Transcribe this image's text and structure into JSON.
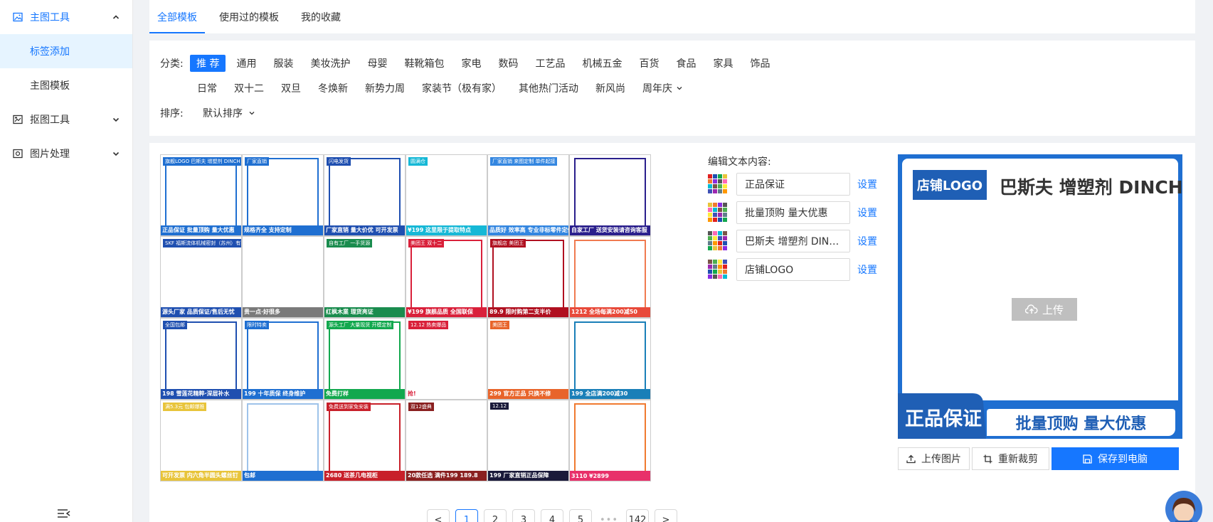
{
  "sidebar": {
    "groups": [
      {
        "label": "主图工具",
        "icon": "image-icon",
        "expanded": true,
        "children": [
          "标签添加",
          "主图模板"
        ]
      },
      {
        "label": "抠图工具",
        "icon": "cutout-icon",
        "expanded": false
      },
      {
        "label": "图片处理",
        "icon": "photo-process-icon",
        "expanded": false
      }
    ],
    "active_child": "标签添加"
  },
  "tabs": [
    {
      "label": "全部模板",
      "active": true
    },
    {
      "label": "使用过的模板",
      "active": false
    },
    {
      "label": "我的收藏",
      "active": false
    }
  ],
  "filters": {
    "category_label": "分类:",
    "categories_row1": [
      "推 荐",
      "通用",
      "服装",
      "美妆洗护",
      "母婴",
      "鞋靴箱包",
      "家电",
      "数码",
      "工艺品",
      "机械五金",
      "百货",
      "食品",
      "家具",
      "饰品"
    ],
    "categories_row2": [
      "日常",
      "双十二",
      "双旦",
      "冬焕新",
      "新势力周",
      "家装节（极有家）",
      "其他热门活动",
      "新风尚"
    ],
    "more_category": "周年庆",
    "active_category": "推 荐",
    "sort_label": "排序:",
    "sort_value": "默认排序"
  },
  "templates": [
    {
      "top": "旗舰LOGO 巴斯夫 增塑剂 DINCH",
      "bottom": "正品保证 批量顶购 量大优惠",
      "frame": "#1f6fd1",
      "bar": "#1f6fd1"
    },
    {
      "top": "厂家直销",
      "bottom": "规格齐全 支持定制",
      "frame": "#1f6fd1",
      "bar": "#1f6fd1"
    },
    {
      "top": "闪电发货",
      "bottom": "厂家直销 量大价优 可开发票",
      "frame": "#1f4fb0",
      "bar": "#1f4fb0"
    },
    {
      "top": "圆满仓",
      "bottom": "¥199 这里限于提取特点",
      "frame": "#ffffff",
      "bar": "#16b8d6"
    },
    {
      "top": "厂家直销 来图定制 单件起接",
      "bottom": "品质好 效率高 专业非标零件定做",
      "frame": "#ffffff",
      "bar": "#3386e0"
    },
    {
      "top": "",
      "bottom": "自家工厂 送货安装请咨询客服",
      "frame": "#2a1f8c",
      "bar": "#2a1f8c"
    },
    {
      "top": "SKF 福斯流体机械密封（苏州）有限公司",
      "bottom": "源头厂家 品质保证/售后无忧",
      "frame": "#ffffff",
      "bar": "#1f4fb0"
    },
    {
      "top": "",
      "bottom": "贵一点·好很多",
      "frame": "#ffffff",
      "bar": "#7a7a7a"
    },
    {
      "top": "自有工厂 一手货源",
      "bottom": "红枫木業 理货亮证",
      "frame": "#ffffff",
      "bar": "#1a8c4e"
    },
    {
      "top": "美团王 双十二",
      "bottom": "¥199 旗舰品质 全国联保",
      "frame": "#d9203a",
      "bar": "#d9203a"
    },
    {
      "top": "旗舰店 美团王",
      "bottom": "89.9 限时购第二支半价",
      "frame": "#b01020",
      "bar": "#b01020"
    },
    {
      "top": "",
      "bottom": "1212 全场每满200减50",
      "frame": "#f07a50",
      "bar": "#e84a3a"
    },
    {
      "top": "全国包邮",
      "bottom": "198 雪莲花精粹·深层补水",
      "frame": "#1f4fb0",
      "bar": "#1f4fb0"
    },
    {
      "top": "限时特卖",
      "bottom": "199 十年质保 终身维护",
      "frame": "#1f6fd1",
      "bar": "#1f6fd1"
    },
    {
      "top": "源头工厂 大量现货 开模定制",
      "bottom": "免费打样",
      "frame": "#12a84e",
      "bar": "#12a84e"
    },
    {
      "top": "12.12 热卖爆品",
      "bottom": "抢!",
      "frame": "#ffffff",
      "bar": "#ffffff"
    },
    {
      "top": "美团王",
      "bottom": "299 官方正品 只换不修",
      "frame": "#ffffff",
      "bar": "#e8642a"
    },
    {
      "top": "",
      "bottom": "199 全店满200减30",
      "frame": "#1a7fb8",
      "bar": "#1a7fb8"
    },
    {
      "top": "满5.3元 包邮爆推",
      "bottom": "可开发票 内六角半圆头螺丝钉",
      "frame": "#ffffff",
      "bar": "#e8c43a"
    },
    {
      "top": "",
      "bottom": "包邮",
      "frame": "#9ec3ea",
      "bar": "#1f6fd1"
    },
    {
      "top": "免费送到家免安装",
      "bottom": "2680 送茶几电视柜",
      "frame": "#c8202a",
      "bar": "#c8202a"
    },
    {
      "top": "双12盛典",
      "bottom": "20款任选 满件199 189.8",
      "frame": "#ffffff",
      "bar": "#8a2020"
    },
    {
      "top": "12.12",
      "bottom": "199 厂家直销正品保障",
      "frame": "#ffffff",
      "bar": "#1a1a3a"
    },
    {
      "top": "",
      "bottom": "3110 ¥2899",
      "frame": "#f07a30",
      "bar": "#e8306a"
    }
  ],
  "pagination": [
    "<",
    "1",
    "2",
    "3",
    "4",
    "5",
    "•••",
    "142",
    ">"
  ],
  "pagination_active": "1",
  "editor": {
    "title": "编辑文本内容:",
    "link_label": "设置",
    "fields": [
      "正品保证",
      "批量顶购 量大优惠",
      "巴斯夫 增塑剂 DIN…",
      "店铺LOGO"
    ]
  },
  "preview": {
    "logo": "店铺LOGO",
    "brand": "巴斯夫 增塑剂 DINCH",
    "upload": "上传",
    "guarantee": "正品保证",
    "deal": "批量顶购 量大优惠"
  },
  "actions": {
    "upload": "上传图片",
    "recrop": "重新裁剪",
    "save": "保存到电脑"
  },
  "colors": {
    "accent": "#1677ff",
    "brand_blue": "#1f6fd1"
  }
}
